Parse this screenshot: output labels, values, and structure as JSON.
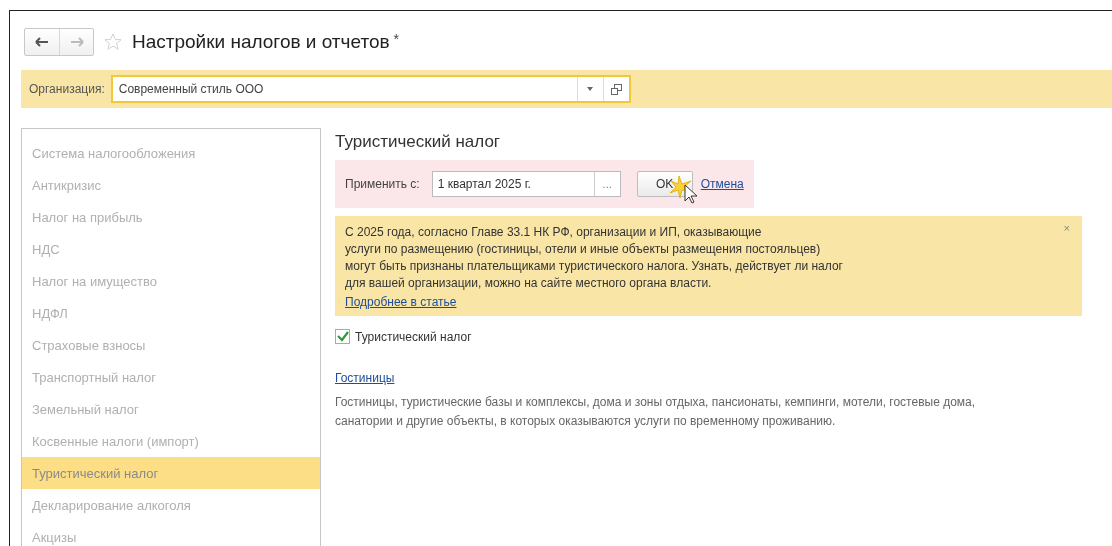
{
  "window": {
    "title": "Настройки налогов и отчетов",
    "modified_mark": "*",
    "favorite": false
  },
  "organization": {
    "label": "Организация:",
    "value": "Современный стиль ООО"
  },
  "sidebar": {
    "items": [
      {
        "label": "Система налогообложения",
        "selected": false
      },
      {
        "label": "Антикризис",
        "selected": false
      },
      {
        "label": "Налог на прибыль",
        "selected": false
      },
      {
        "label": "НДС",
        "selected": false
      },
      {
        "label": "Налог на имущество",
        "selected": false
      },
      {
        "label": "НДФЛ",
        "selected": false
      },
      {
        "label": "Страховые взносы",
        "selected": false
      },
      {
        "label": "Транспортный налог",
        "selected": false
      },
      {
        "label": "Земельный налог",
        "selected": false
      },
      {
        "label": "Косвенные налоги (импорт)",
        "selected": false
      },
      {
        "label": "Туристический налог",
        "selected": true
      },
      {
        "label": "Декларирование алкоголя",
        "selected": false
      },
      {
        "label": "Акцизы",
        "selected": false
      }
    ]
  },
  "section": {
    "title": "Туристический налог",
    "apply": {
      "label": "Применить с:",
      "value": "1 квартал 2025 г.",
      "picker": "...",
      "ok": "OK",
      "cancel": "Отмена"
    },
    "notice": {
      "lines": [
        "С 2025 года, согласно Главе 33.1 НК РФ, организации и ИП, оказывающие",
        "услуги по размещению (гостиницы, отели и иные объекты размещения постояльцев)",
        "могут быть признаны плательщиками туристического налога. Узнать, действует ли налог",
        "для вашей организации, можно на сайте местного органа власти."
      ],
      "link": "Подробнее в статье",
      "close": "×"
    },
    "checkbox": {
      "label": "Туристический налог",
      "checked": true
    },
    "hotels": {
      "link": "Гостиницы",
      "description": "Гостиницы, туристические базы и комплексы, дома и зоны отдыха, пансионаты, кемпинги, мотели, гостевые дома, санатории и другие объекты, в которых оказываются услуги по временному проживанию."
    }
  }
}
